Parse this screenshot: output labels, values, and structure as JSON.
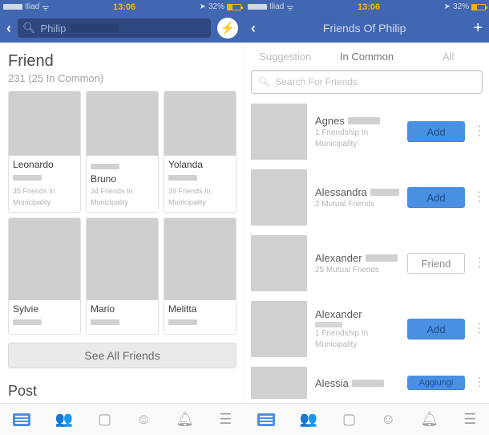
{
  "statusbar": {
    "carrier": "Iliad",
    "time": "13:06",
    "battery": "32%"
  },
  "left": {
    "search_query": "Philip",
    "section_title": "Friend",
    "section_sub": "231 (25 In Common)",
    "grid": [
      {
        "name": "Leonardo",
        "sub": "35 Friends In",
        "sub2": "Municipality"
      },
      {
        "name": "Bruno",
        "sub": "34 Friends In",
        "sub2": "Municipality"
      },
      {
        "name": "Yolanda",
        "sub": "39 Friends In",
        "sub2": "Municipality"
      },
      {
        "name": "Sylvie",
        "sub": "",
        "sub2": ""
      },
      {
        "name": "Mario",
        "sub": "",
        "sub2": ""
      },
      {
        "name": "Melitta",
        "sub": "",
        "sub2": ""
      }
    ],
    "see_all": "See All Friends",
    "post_title": "Post"
  },
  "right": {
    "title": "Friends Of Philip",
    "tabs": {
      "suggestion": "Suggestion",
      "in_common": "In Common",
      "all": "All"
    },
    "search_placeholder": "Search For Friends",
    "rows": [
      {
        "name": "Agnes",
        "sub": "1 Friendship In",
        "sub2": "Municipality",
        "btn": "Add",
        "btn_kind": "add"
      },
      {
        "name": "Alessandra",
        "sub": "2 Mutual Friends",
        "sub2": "",
        "btn": "Add",
        "btn_kind": "add"
      },
      {
        "name": "Alexander",
        "sub": "25 Mutual Friends",
        "sub2": "",
        "btn": "Friend",
        "btn_kind": "friend"
      },
      {
        "name": "Alexander",
        "sub": "1 Friendship In",
        "sub2": "Municipality",
        "btn": "Add",
        "btn_kind": "add"
      },
      {
        "name": "Alessia",
        "sub": "",
        "sub2": "",
        "btn": "Aggiungi",
        "btn_kind": "add"
      }
    ]
  },
  "icons": {
    "search": "search-icon",
    "messenger": "messenger-icon",
    "chevron": "chevron-left-icon",
    "plus": "plus-icon",
    "news": "news-feed-icon",
    "people": "friends-icon",
    "video": "video-icon",
    "groups": "groups-icon",
    "bell": "notifications-icon",
    "menu": "menu-icon",
    "kebab": "more-icon"
  }
}
